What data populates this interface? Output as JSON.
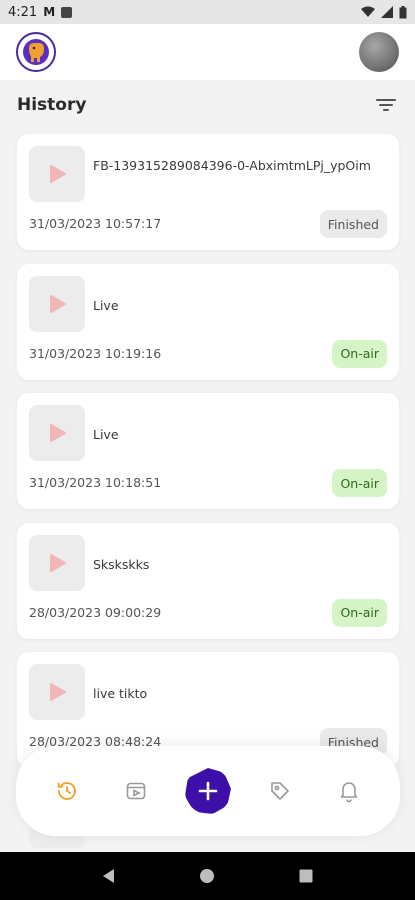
{
  "status_bar": {
    "time": "4:21",
    "carrier_glyph": "M"
  },
  "header": {
    "logo_icon": "elephant-logo-icon",
    "avatar": "user-avatar"
  },
  "page": {
    "title": "History"
  },
  "history": [
    {
      "title": "FB-139315289084396-0-AbximtmLPj_ypOim",
      "date": "31/03/2023 10:57:17",
      "status": "Finished",
      "status_kind": "finished"
    },
    {
      "title": "Live",
      "date": "31/03/2023 10:19:16",
      "status": "On-air",
      "status_kind": "onair"
    },
    {
      "title": "Live",
      "date": "31/03/2023 10:18:51",
      "status": "On-air",
      "status_kind": "onair"
    },
    {
      "title": "Skskskks",
      "date": "28/03/2023 09:00:29",
      "status": "On-air",
      "status_kind": "onair"
    },
    {
      "title": "live tikto",
      "date": "28/03/2023 08:48:24",
      "status": "Finished",
      "status_kind": "finished"
    }
  ],
  "colors": {
    "accent": "#3d0fa8",
    "active_tab": "#f0a020",
    "onair_bg": "#d5f5c7",
    "finished_bg": "#eaeaea",
    "play_icon": "#f3b6b6"
  },
  "bottom_nav": [
    "history-icon",
    "video-library-icon",
    "add-icon",
    "tag-icon",
    "bell-icon"
  ]
}
